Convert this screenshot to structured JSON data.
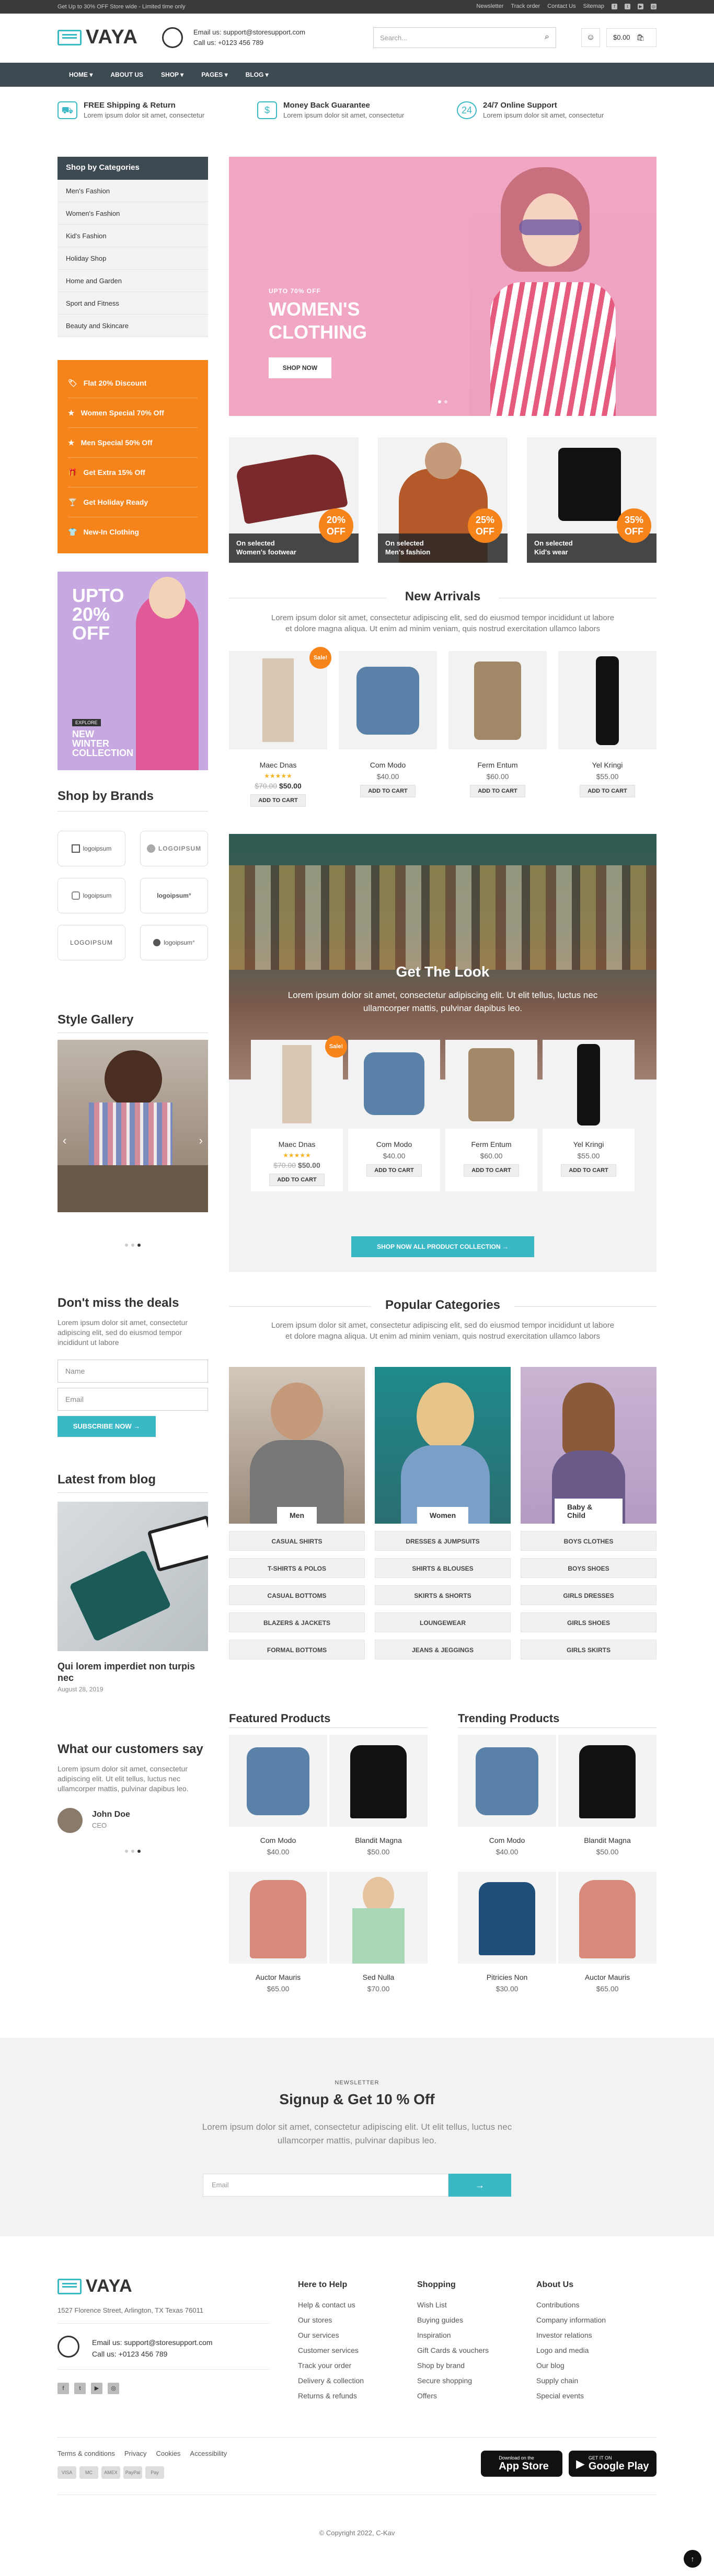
{
  "topbar": {
    "promo": "Get Up to 30% OFF Store wide - Limited time only",
    "links": [
      "Newsletter",
      "Track order",
      "Contact Us",
      "Sitemap"
    ]
  },
  "header": {
    "logo": "VAYA",
    "email": "Email us: support@storesupport.com",
    "phone": "Call us: +0123 456 789",
    "search_placeholder": "Search...",
    "cart_total": "$0.00"
  },
  "nav": {
    "items": [
      "Home",
      "About us",
      "Shop",
      "Pages",
      "Blog"
    ]
  },
  "services": [
    {
      "title": "FREE Shipping & Return",
      "sub": "Lorem ipsum dolor sit amet, consectetur",
      "icon": "truck-icon"
    },
    {
      "title": "Money Back Guarantee",
      "sub": "Lorem ipsum dolor sit amet, consectetur",
      "icon": "money-icon"
    },
    {
      "title": "24/7 Online Support",
      "sub": "Lorem ipsum dolor sit amet, consectetur",
      "icon": "support-icon"
    }
  ],
  "categories": {
    "title": "Shop by Categories",
    "items": [
      "Men's Fashion",
      "Women's Fashion",
      "Kid's Fashion",
      "Holiday Shop",
      "Home and Garden",
      "Sport and Fitness",
      "Beauty and Skincare"
    ]
  },
  "offers": [
    "Flat 20% Discount",
    "Women Special 70% Off",
    "Men Special 50% Off",
    "Get Extra 15% Off",
    "Get Holiday Ready",
    "New-In Clothing"
  ],
  "promo": {
    "big": "UPTO 20% OFF",
    "tag": "EXPLORE",
    "line": "NEW WINTER COLLECTION"
  },
  "brands": {
    "title": "Shop by Brands",
    "items": [
      "logoipsum",
      "LOGOIPSUM",
      "logoipsum",
      "logoipsum°",
      "LOGOIPSUM",
      "logoipsum°"
    ]
  },
  "gallery": {
    "title": "Style Gallery"
  },
  "deals": {
    "title": "Don't miss the deals",
    "text": "Lorem ipsum dolor sit amet, consectetur adipiscing elit, sed do eiusmod tempor incididunt ut labore",
    "name_ph": "Name",
    "email_ph": "Email",
    "button": "SUBSCRIBE NOW →"
  },
  "blog": {
    "title": "Latest from blog",
    "post": "Qui lorem imperdiet non turpis nec",
    "date": "August 28, 2019"
  },
  "testimonial": {
    "title": "What our customers say",
    "text": "Lorem ipsum dolor sit amet, consectetur adipiscing elit. Ut elit tellus, luctus nec ullamcorper mattis, pulvinar dapibus leo.",
    "name": "John Doe",
    "role": "CEO"
  },
  "hero": {
    "eyebrow": "UPTO 70% OFF",
    "title1": "WOMEN'S",
    "title2": "CLOTHING",
    "button": "SHOP NOW"
  },
  "tiles": [
    {
      "cap1": "On selected",
      "cap2": "Women's footwear",
      "pct": "20%",
      "off": "OFF"
    },
    {
      "cap1": "On selected",
      "cap2": "Men's fashion",
      "pct": "25%",
      "off": "OFF"
    },
    {
      "cap1": "On selected",
      "cap2": "Kid's wear",
      "pct": "35%",
      "off": "OFF"
    }
  ],
  "arrivals": {
    "title": "New Arrivals",
    "text1": "Lorem ipsum dolor sit amet, consectetur adipiscing elit, sed do eiusmod tempor incididunt ut labore",
    "text2": "et dolore magna aliqua. Ut enim ad minim veniam, quis nostrud exercitation ullamco labors",
    "sale": "Sale!",
    "products": [
      {
        "name": "Maec Dnas",
        "old": "$70.00",
        "price": "$50.00",
        "btn": "ADD TO CART"
      },
      {
        "name": "Com Modo",
        "price": "$40.00",
        "btn": "ADD TO CART"
      },
      {
        "name": "Ferm Entum",
        "price": "$60.00",
        "btn": "ADD TO CART"
      },
      {
        "name": "Yel Kringi",
        "price": "$55.00",
        "btn": "ADD TO CART"
      }
    ]
  },
  "look": {
    "title": "Get The Look",
    "text1": "Lorem ipsum dolor sit amet, consectetur adipiscing elit. Ut elit tellus, luctus nec",
    "text2": "ullamcorper mattis, pulvinar dapibus leo.",
    "button": "SHOP NOW ALL PRODUCT COLLECTION →",
    "sale": "Sale!",
    "products": [
      {
        "name": "Maec Dnas",
        "old": "$70.00",
        "price": "$50.00",
        "btn": "ADD TO CART"
      },
      {
        "name": "Com Modo",
        "price": "$40.00",
        "btn": "ADD TO CART"
      },
      {
        "name": "Ferm Entum",
        "price": "$60.00",
        "btn": "ADD TO CART"
      },
      {
        "name": "Yel Kringi",
        "price": "$55.00",
        "btn": "ADD TO CART"
      }
    ]
  },
  "popular": {
    "title": "Popular Categories",
    "text1": "Lorem ipsum dolor sit amet, consectetur adipiscing elit, sed do eiusmod tempor incididunt ut labore",
    "text2": "et dolore magna aliqua. Ut enim ad minim veniam, quis nostrud exercitation ullamco labors",
    "cols": [
      {
        "label": "Men",
        "items": [
          "Casual Shirts",
          "T-Shirts & Polos",
          "Casual Bottoms",
          "Blazers & Jackets",
          "Formal Bottoms"
        ]
      },
      {
        "label": "Women",
        "items": [
          "Dresses & Jumpsuits",
          "Shirts & Blouses",
          "Skirts & Shorts",
          "Loungewear",
          "Jeans & Jeggings"
        ]
      },
      {
        "label": "Baby & Child",
        "items": [
          "Boys Clothes",
          "Boys Shoes",
          "Girls Dresses",
          "Girls Shoes",
          "Girls Skirts"
        ]
      }
    ]
  },
  "featured": {
    "title": "Featured Products",
    "items": [
      {
        "name": "Com Modo",
        "price": "$40.00"
      },
      {
        "name": "Blandit Magna",
        "price": "$50.00"
      },
      {
        "name": "Auctor Mauris",
        "price": "$65.00"
      },
      {
        "name": "Sed Nulla",
        "price": "$70.00"
      }
    ]
  },
  "trending": {
    "title": "Trending Products",
    "items": [
      {
        "name": "Com Modo",
        "price": "$40.00"
      },
      {
        "name": "Blandit Magna",
        "price": "$50.00"
      },
      {
        "name": "Pitricies Non",
        "price": "$30.00"
      },
      {
        "name": "Auctor Mauris",
        "price": "$65.00"
      }
    ]
  },
  "newsletter": {
    "eyebrow": "NEWSLETTER",
    "title": "Signup & Get 10 % Off",
    "text1": "Lorem ipsum dolor sit amet, consectetur adipiscing elit. Ut elit tellus, luctus nec",
    "text2": "ullamcorper mattis, pulvinar dapibus leo.",
    "placeholder": "Email",
    "button": "→"
  },
  "footer": {
    "logo": "VAYA",
    "address": "1527 Florence Street, Arlington, TX Texas 76011",
    "email": "Email us: support@storesupport.com",
    "phone": "Call us: +0123 456 789",
    "cols": [
      {
        "title": "Here to Help",
        "items": [
          "Help & contact us",
          "Our stores",
          "Our services",
          "Customer services",
          "Track your order",
          "Delivery & collection",
          "Returns & refunds"
        ]
      },
      {
        "title": "Shopping",
        "items": [
          "Wish List",
          "Buying guides",
          "Inspiration",
          "Gift Cards & vouchers",
          "Shop by brand",
          "Secure shopping",
          "Offers"
        ]
      },
      {
        "title": "About Us",
        "items": [
          "Contributions",
          "Company information",
          "Investor relations",
          "Logo and media",
          "Our blog",
          "Supply chain",
          "Special events"
        ]
      }
    ],
    "legal": [
      "Terms & conditions",
      "Privacy",
      "Cookies",
      "Accessibility"
    ],
    "pay": [
      "VISA",
      "MC",
      "AMEX",
      "PayPal",
      "Pay"
    ],
    "app1_small": "Download on the",
    "app1": "App Store",
    "app2_small": "GET IT ON",
    "app2": "Google Play",
    "copyright": "© Copyright 2022, C-Kav"
  },
  "colors": {
    "teal": "#3bb8c6",
    "orange": "#f7831b",
    "nav": "#3e4a52"
  }
}
